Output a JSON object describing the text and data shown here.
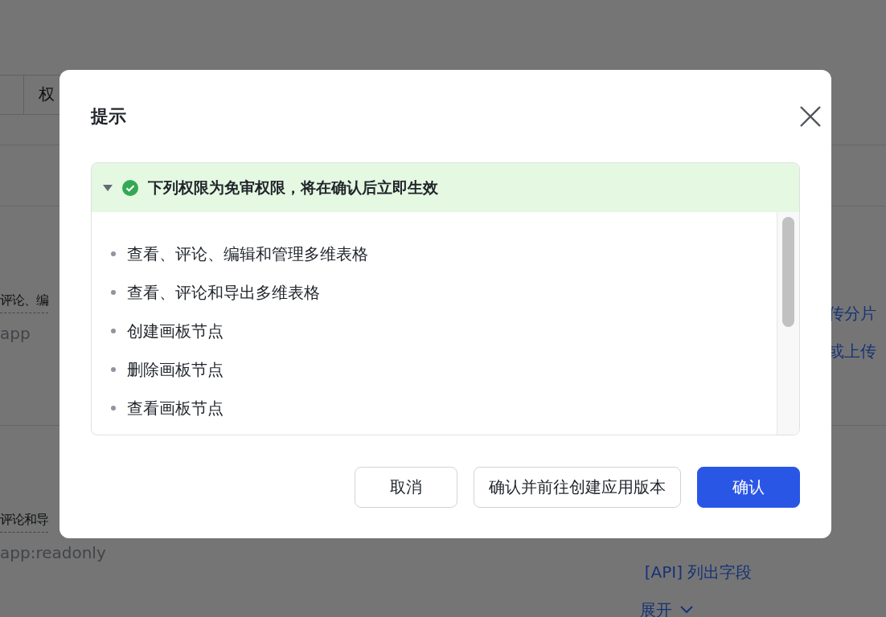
{
  "page": {
    "tab_field": "权",
    "rows": [
      {
        "name": "评论、编",
        "scope": "app"
      },
      {
        "name": "评论和导",
        "scope": "app:readonly"
      }
    ],
    "right_links": [
      "传分片",
      "或上传"
    ],
    "lower_link": "[API] 列出字段",
    "expand_link": "展开"
  },
  "dialog": {
    "title": "提示",
    "notice": {
      "expanded": true,
      "message": "下列权限为免审权限，将在确认后立即生效",
      "items": [
        "查看、评论、编辑和管理多维表格",
        "查看、评论和导出多维表格",
        "创建画板节点",
        "删除画板节点",
        "查看画板节点"
      ]
    },
    "buttons": [
      {
        "label": "取消",
        "kind": "default"
      },
      {
        "label": "确认并前往创建应用版本",
        "kind": "default"
      },
      {
        "label": "确认",
        "kind": "primary"
      }
    ]
  }
}
